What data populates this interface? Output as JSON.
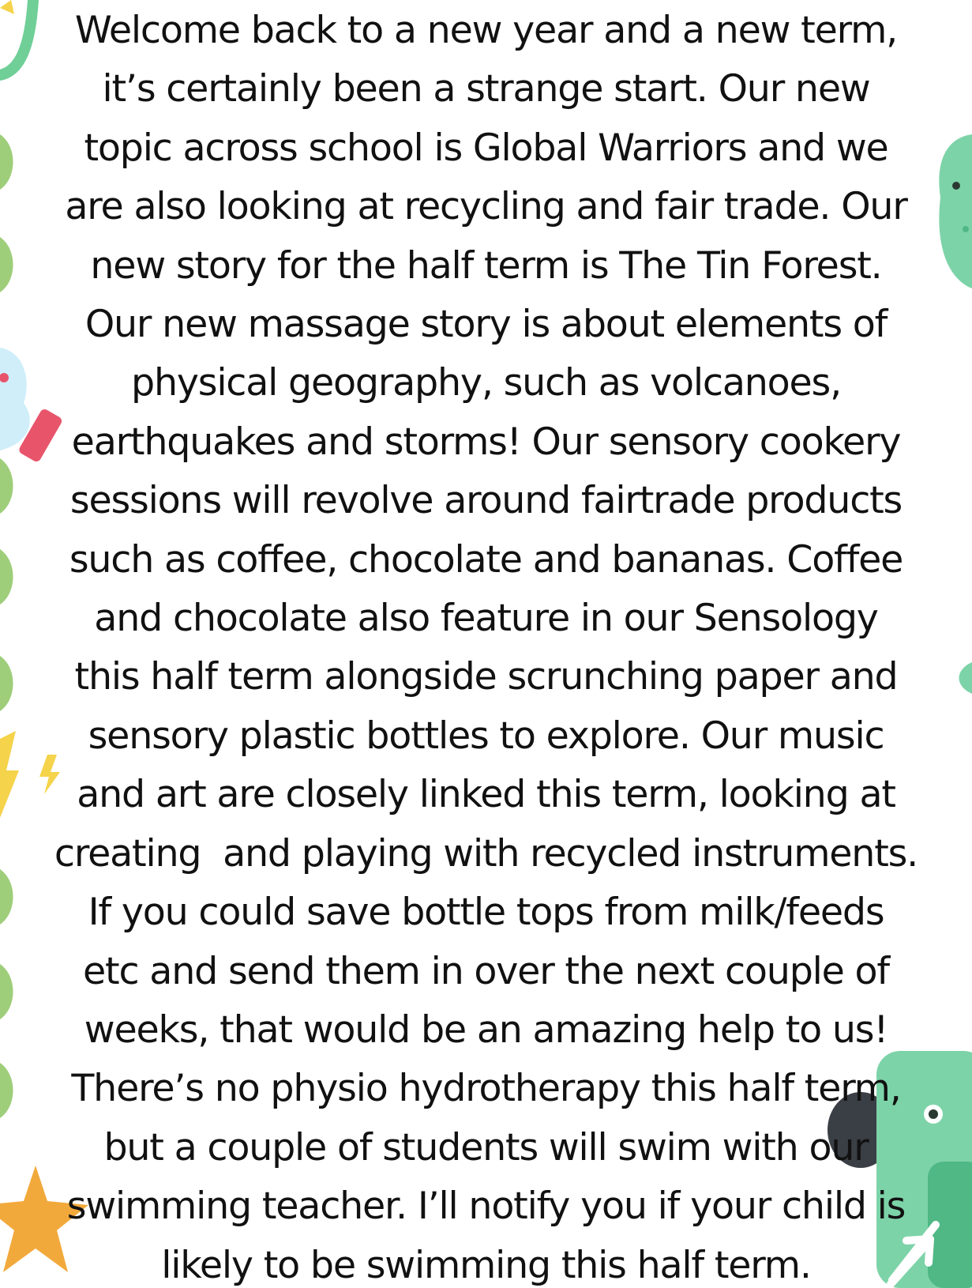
{
  "text_lines": [
    "Welcome back to a new year and a new term,",
    "it’s certainly been a strange start. Our new",
    "topic across school is Global Warriors and we",
    "are also looking at recycling and fair trade. Our",
    "new story for the half term is The Tin Forest.",
    "Our new massage story is about elements of",
    "physical geography, such as volcanoes,",
    "earthquakes and storms! Our sensory cookery",
    "sessions will revolve around fairtrade products",
    "such as coffee, chocolate and bananas. Coffee",
    "and chocolate also feature in our Sensology",
    "this half term alongside scrunching paper and",
    "sensory plastic bottles to explore. Our music",
    "and art are closely linked this term, looking at",
    "creating  and playing with recycled instruments.",
    "If you could save bottle tops from milk/feeds",
    "etc and send them in over the next couple of",
    "weeks, that would be an amazing help to us!",
    "There’s no physio hydrotherapy this half term,",
    "but a couple of students will swim with our",
    "swimming teacher. I’ll notify you if your child is",
    "likely to be swimming this half term."
  ],
  "colors": {
    "text": "#111111",
    "background": "#ffffff",
    "leaf_green": "#9fce7a",
    "mint_green": "#6fcf97",
    "monster_green": "#7dd3a8",
    "monster_dark_green": "#4fb885",
    "light_blue": "#cfeefa",
    "coral_red": "#e8556b",
    "yellow": "#f5d34a",
    "orange_star": "#f2a93b",
    "dark_gray": "#3a3f45"
  },
  "decorations": [
    "leaf-icon",
    "green-swoosh-icon",
    "green-monster-icon",
    "water-splash-icon",
    "eraser-icon",
    "lightning-bolt-icon",
    "star-icon",
    "trash-bin-monster-icon",
    "arrow-icon"
  ]
}
